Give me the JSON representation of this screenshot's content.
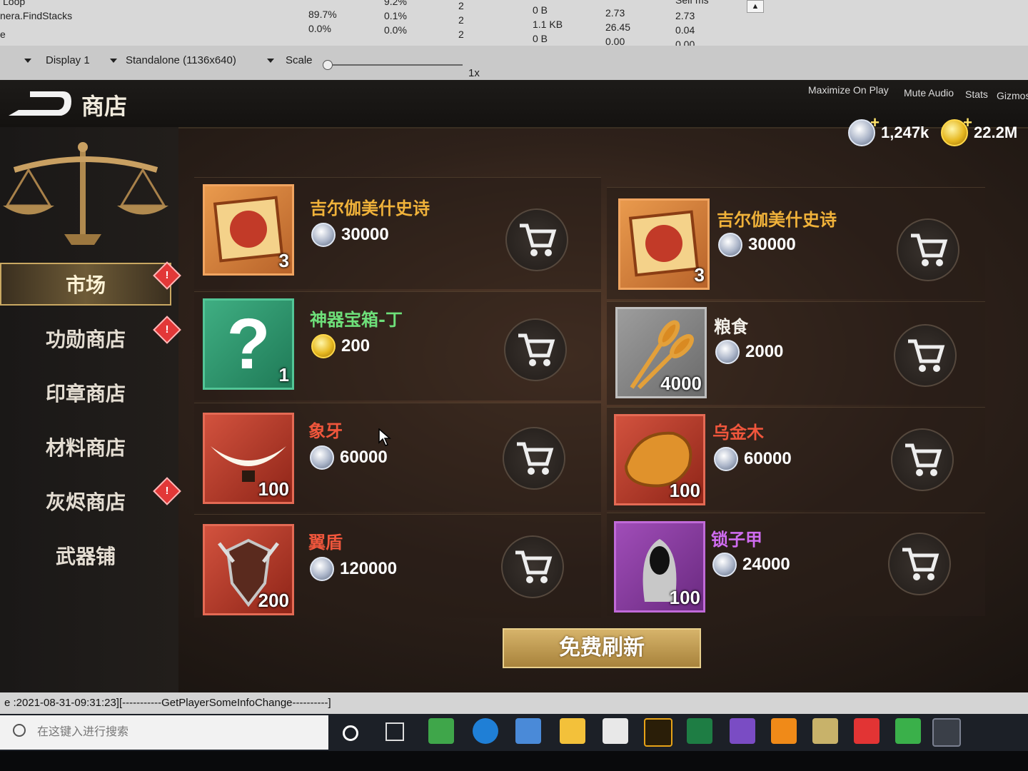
{
  "profiler": {
    "row_label_1": "Loop",
    "row_label_2": "nera.FindStacks",
    "row_label_3": "e",
    "col1": [
      "89.7%",
      "0.0%"
    ],
    "col2": [
      "9.2%",
      "0.1%",
      "0.0%"
    ],
    "col3": [
      "2",
      "2",
      "2"
    ],
    "col4": [
      "0 B",
      "1.1 KB",
      "0 B"
    ],
    "col5": [
      "2.73",
      "26.45",
      "0.00"
    ],
    "col6_header": "Self ms",
    "col6": [
      "2.73",
      "0.04",
      "0.00"
    ]
  },
  "toolbar": {
    "display": "Display 1",
    "resolution": "Standalone (1136x640)",
    "scale_label": "Scale",
    "scale_value": "1x",
    "maximize": "Maximize On Play",
    "mute": "Mute Audio",
    "stats": "Stats",
    "gizmos": "Gizmos"
  },
  "game": {
    "title": "商店",
    "currency_silver": "1,247k",
    "currency_gold": "22.2M",
    "nav": [
      {
        "label": "市场"
      },
      {
        "label": "功勋商店"
      },
      {
        "label": "印章商店"
      },
      {
        "label": "材料商店"
      },
      {
        "label": "灰烬商店"
      },
      {
        "label": "武器铺"
      }
    ],
    "badge_text": "!",
    "items": [
      {
        "name": "吉尔伽美什史诗",
        "price": "30000",
        "count": "3",
        "name_color": "#f0b23a",
        "coin": "silver",
        "frame": "orange"
      },
      {
        "name": "吉尔伽美什史诗",
        "price": "30000",
        "count": "3",
        "name_color": "#f0b23a",
        "coin": "silver",
        "frame": "orange"
      },
      {
        "name": "神器宝箱-丁",
        "price": "200",
        "count": "1",
        "name_color": "#6ee07a",
        "coin": "gold",
        "frame": "green"
      },
      {
        "name": "粮食",
        "price": "2000",
        "count": "4000",
        "name_color": "#f2efe8",
        "coin": "silver",
        "frame": "grey"
      },
      {
        "name": "象牙",
        "price": "60000",
        "count": "100",
        "name_color": "#f0563c",
        "coin": "silver",
        "frame": "red"
      },
      {
        "name": "乌金木",
        "price": "60000",
        "count": "100",
        "name_color": "#f0563c",
        "coin": "silver",
        "frame": "red"
      },
      {
        "name": "翼盾",
        "price": "120000",
        "count": "200",
        "name_color": "#f0563c",
        "coin": "silver",
        "frame": "red"
      },
      {
        "name": "锁子甲",
        "price": "24000",
        "count": "100",
        "name_color": "#cf6cf0",
        "coin": "silver",
        "frame": "purple"
      }
    ],
    "refresh_label": "免费刷新"
  },
  "console": {
    "line": "e :2021-08-31-09:31:23][-----------GetPlayerSomeInfoChange----------]"
  },
  "taskbar": {
    "search_placeholder": "在这键入进行搜索"
  }
}
